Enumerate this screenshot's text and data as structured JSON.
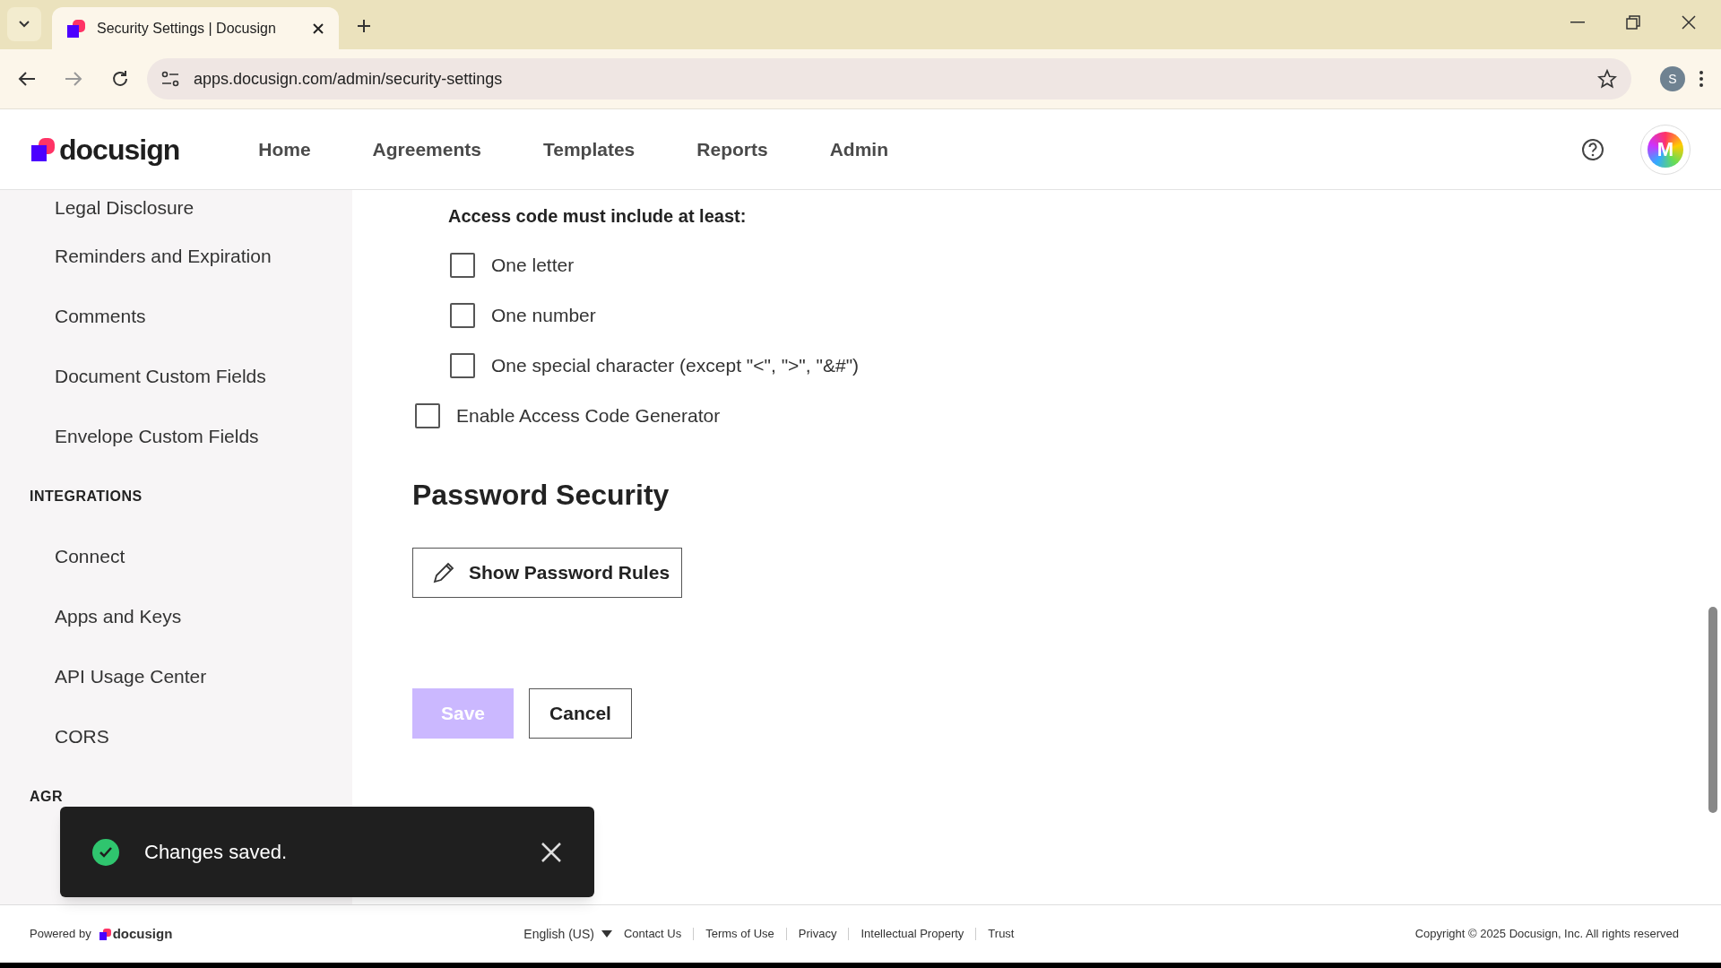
{
  "browser": {
    "tab_title": "Security Settings | Docusign",
    "url": "apps.docusign.com/admin/security-settings",
    "profile_initial": "S"
  },
  "header": {
    "logo": "docusign",
    "nav": [
      {
        "label": "Home",
        "selected": false
      },
      {
        "label": "Agreements",
        "selected": false
      },
      {
        "label": "Templates",
        "selected": false
      },
      {
        "label": "Reports",
        "selected": false
      },
      {
        "label": "Admin",
        "selected": false
      }
    ],
    "avatar_initial": "M"
  },
  "sidebar": {
    "items": [
      {
        "kind": "item",
        "label": "Legal Disclosure"
      },
      {
        "kind": "item",
        "label": "Reminders and Expiration"
      },
      {
        "kind": "item",
        "label": "Comments"
      },
      {
        "kind": "item",
        "label": "Document Custom Fields"
      },
      {
        "kind": "item",
        "label": "Envelope Custom Fields"
      },
      {
        "kind": "heading",
        "label": "INTEGRATIONS"
      },
      {
        "kind": "item",
        "label": "Connect"
      },
      {
        "kind": "item",
        "label": "Apps and Keys"
      },
      {
        "kind": "item",
        "label": "API Usage Center"
      },
      {
        "kind": "item",
        "label": "CORS"
      },
      {
        "kind": "heading",
        "label": "AGR"
      }
    ]
  },
  "form": {
    "access_code_label": "Access code must include at least:",
    "requirements": [
      {
        "label": "One letter",
        "checked": false
      },
      {
        "label": "One number",
        "checked": false
      },
      {
        "label": "One special character (except \"<\", \">\", \"&#\")",
        "checked": false
      }
    ],
    "generator": {
      "label": "Enable Access Code Generator",
      "checked": false
    },
    "password_heading": "Password Security",
    "show_rules_button": "Show Password Rules",
    "save_button": {
      "label": "Save",
      "disabled": true
    },
    "cancel_button": "Cancel"
  },
  "toast": {
    "message": "Changes saved."
  },
  "footer": {
    "powered_by": "Powered by",
    "logo": "docusign",
    "language": "English (US)",
    "links": [
      "Contact Us",
      "Terms of Use",
      "Privacy",
      "Intellectual Property",
      "Trust"
    ],
    "copyright": "Copyright © 2025 Docusign, Inc. All rights reserved"
  }
}
